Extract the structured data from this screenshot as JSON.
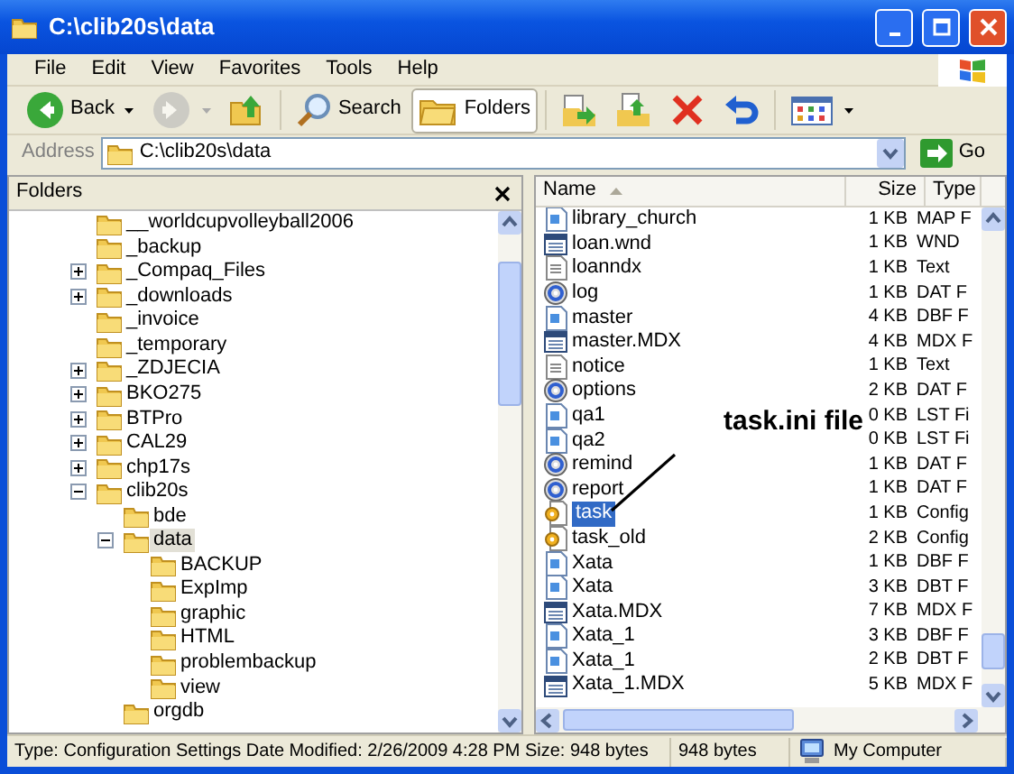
{
  "window": {
    "title": "C:\\clib20s\\data"
  },
  "menu": [
    "File",
    "Edit",
    "View",
    "Favorites",
    "Tools",
    "Help"
  ],
  "toolbar": [
    {
      "kind": "back",
      "label": "Back",
      "disabled": false,
      "selected": false
    },
    {
      "kind": "forward",
      "disabled": true,
      "selected": false
    },
    {
      "kind": "up",
      "disabled": false,
      "selected": false
    },
    {
      "kind": "search",
      "label": "Search",
      "disabled": false,
      "selected": false
    },
    {
      "kind": "folders",
      "label": "Folders",
      "disabled": false,
      "selected": true
    },
    {
      "kind": "move",
      "disabled": false,
      "selected": false
    },
    {
      "kind": "copy",
      "disabled": false,
      "selected": false
    },
    {
      "kind": "delete",
      "disabled": false,
      "selected": false
    },
    {
      "kind": "undo",
      "disabled": false,
      "selected": false
    },
    {
      "kind": "views",
      "disabled": false,
      "selected": false
    }
  ],
  "address": {
    "label": "Address",
    "value": "C:\\clib20s\\data",
    "go": "Go"
  },
  "folders_pane": {
    "title": "Folders",
    "tree": [
      {
        "label": "__worldcupvolleyball2006",
        "selected": false
      },
      {
        "label": "_backup",
        "selected": false
      },
      {
        "label": "_Compaq_Files",
        "expanded": false,
        "selected": false
      },
      {
        "label": "_downloads",
        "expanded": false,
        "selected": false
      },
      {
        "label": "_invoice",
        "selected": false
      },
      {
        "label": "_temporary",
        "selected": false
      },
      {
        "label": "_ZDJECIA",
        "expanded": false,
        "selected": false
      },
      {
        "label": "BKO275",
        "expanded": false,
        "selected": false
      },
      {
        "label": "BTPro",
        "expanded": false,
        "selected": false
      },
      {
        "label": "CAL29",
        "expanded": false,
        "selected": false
      },
      {
        "label": "chp17s",
        "expanded": false,
        "selected": false
      },
      {
        "label": "clib20s",
        "expanded": true,
        "selected": false,
        "children": [
          {
            "label": "bde",
            "selected": false
          },
          {
            "label": "data",
            "expanded": true,
            "selected": true,
            "children": [
              {
                "label": "BACKUP",
                "selected": false
              },
              {
                "label": "ExpImp",
                "selected": false
              },
              {
                "label": "graphic",
                "selected": false
              },
              {
                "label": "HTML",
                "selected": false
              },
              {
                "label": "problembackup",
                "selected": false
              },
              {
                "label": "view",
                "selected": false
              }
            ]
          },
          {
            "label": "orgdb",
            "selected": false
          }
        ]
      }
    ]
  },
  "file_list": {
    "columns": [
      "Name",
      "Size",
      "Type"
    ],
    "rows": [
      {
        "name": "library_church",
        "size": "1 KB",
        "type": "MAP F",
        "kind": "map",
        "selected": false
      },
      {
        "name": "loan.wnd",
        "size": "1 KB",
        "type": "WND",
        "kind": "wnd",
        "selected": false
      },
      {
        "name": "loanndx",
        "size": "1 KB",
        "type": "Text",
        "kind": "text",
        "selected": false
      },
      {
        "name": "log",
        "size": "1 KB",
        "type": "DAT F",
        "kind": "dat",
        "selected": false
      },
      {
        "name": "master",
        "size": "4 KB",
        "type": "DBF F",
        "kind": "map",
        "selected": false
      },
      {
        "name": "master.MDX",
        "size": "4 KB",
        "type": "MDX F",
        "kind": "wnd",
        "selected": false
      },
      {
        "name": "notice",
        "size": "1 KB",
        "type": "Text",
        "kind": "text",
        "selected": false
      },
      {
        "name": "options",
        "size": "2 KB",
        "type": "DAT F",
        "kind": "dat",
        "selected": false
      },
      {
        "name": "qa1",
        "size": "0 KB",
        "type": "LST Fi",
        "kind": "map",
        "selected": false
      },
      {
        "name": "qa2",
        "size": "0 KB",
        "type": "LST Fi",
        "kind": "map",
        "selected": false
      },
      {
        "name": "remind",
        "size": "1 KB",
        "type": "DAT F",
        "kind": "dat",
        "selected": false
      },
      {
        "name": "report",
        "size": "1 KB",
        "type": "DAT F",
        "kind": "dat",
        "selected": false
      },
      {
        "name": "task",
        "size": "1 KB",
        "type": "Config",
        "kind": "config",
        "selected": true
      },
      {
        "name": "task_old",
        "size": "2 KB",
        "type": "Config",
        "kind": "config",
        "selected": false
      },
      {
        "name": "Xata",
        "size": "1 KB",
        "type": "DBF F",
        "kind": "map",
        "selected": false
      },
      {
        "name": "Xata",
        "size": "3 KB",
        "type": "DBT F",
        "kind": "map",
        "selected": false
      },
      {
        "name": "Xata.MDX",
        "size": "7 KB",
        "type": "MDX F",
        "kind": "wnd",
        "selected": false
      },
      {
        "name": "Xata_1",
        "size": "3 KB",
        "type": "DBF F",
        "kind": "map",
        "selected": false
      },
      {
        "name": "Xata_1",
        "size": "2 KB",
        "type": "DBT F",
        "kind": "map",
        "selected": false
      },
      {
        "name": "Xata_1.MDX",
        "size": "5 KB",
        "type": "MDX F",
        "kind": "wnd",
        "selected": false
      }
    ]
  },
  "annotation": {
    "text": "task.ini file"
  },
  "status_bar": [
    "Type: Configuration Settings Date Modified: 2/26/2009 4:28 PM Size: 948 bytes",
    "948 bytes",
    "My Computer"
  ]
}
